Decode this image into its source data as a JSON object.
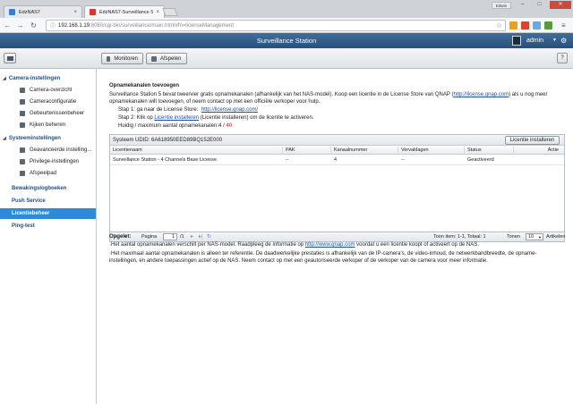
{
  "browser": {
    "tabs": [
      {
        "title": "EdzNAS7",
        "active": false
      },
      {
        "title": "EdzNAS7-Surveillance St",
        "active": true
      }
    ],
    "profile": "Edwin",
    "url_host": "192.168.1.19",
    "url_path": ":8080/cgi-bin/surveillance/main.html#fn=licenseManagement"
  },
  "app": {
    "title": "Surveillance Station",
    "user": "admin",
    "monitor_label": "Monitoren",
    "playback_label": "Afspelen",
    "help_label": "?"
  },
  "sidebar": {
    "groups": [
      {
        "label": "Camera-instellingen",
        "items": [
          "Camera-overzicht",
          "Cameraconfiguratie",
          "Gebeurtenissenbeheer",
          "Kijken beheren"
        ]
      },
      {
        "label": "Systeeminstellingen",
        "items": [
          "Geavanceerde instelling...",
          "Privilege-instellingen",
          "Afspeelpad"
        ]
      }
    ],
    "top_items": [
      "Bewakingslogboeken",
      "Push Service",
      "Licentiebeheer",
      "Ping-test"
    ],
    "active": "Licentiebeheer"
  },
  "main": {
    "heading": "Opnamekanalen toevoegen",
    "intro_1": "Surveillance Station 5 bevat twee/vier gratis opnamekanalen (afhankelijk van het NAS-model). Koop een licentie in de License Store van QNAP (",
    "intro_link": "http://license.qnap.com",
    "intro_2": ") als u nog meer",
    "intro_3": "opnamekanalen wilt toevoegen, of neem contact op met een officiële verkoper voor hulp.",
    "step1_text": "Stap 1: ga naar de License Store:",
    "step1_link": "http://license.qnap.com/",
    "step2_text": "Stap 2: Klik op",
    "step2_link": "Licentie installeren",
    "step2_rest": "(Licentie installeren) om de licentie te activeren.",
    "current_text": "Huidig / maximum aantal opnamekanalen:4 /",
    "current_max": "40"
  },
  "grid": {
    "udid_label": "Systeem UDID: 6A618950EED89BQ152E000",
    "install_button": "Licentie installeren",
    "columns": [
      "Licentienaam",
      "PAK",
      "Kanaalnummer",
      "Vervaldagen",
      "Status",
      "Actie"
    ],
    "rows": [
      {
        "name": "Surveillance Station - 4 Channels Base License",
        "pak": "--",
        "channels": "4",
        "expiry": "--",
        "status": "Geactiveerd",
        "action": ""
      }
    ]
  },
  "pager": {
    "page_label": "Pagina",
    "page_value": "1",
    "page_total": "/1",
    "summary": "Toon item: 1-1, Totaal: 1",
    "show_label": "Tonen",
    "per_page": "10",
    "items_label": "Artikelen"
  },
  "notes": {
    "title": "Opgelet:",
    "note1_a": "·Het aantal opnamekanalen verschilt per NAS-model. Raadpleeg de informatie op",
    "note1_link": "http://www.qnap.com",
    "note1_b": "voordat u een licentie koopt of activeert op de NAS.",
    "note2_line1": "·Het maximaal aantal opnamekanalen is alleen ter referentie. De daadwerkelijke prestaties is afhankelijk van de IP-camera's, de video-inhoud, de netwerkbandbreedte, de opname-",
    "note2_line2": "instellingen, en andere toepassingen actief op de NAS. Neem contact op met een geautoriseerde verkoper of de verkoper van de camera voor meer informatie."
  },
  "colors": {
    "header": "#2f5d8a",
    "active_nav": "#2c8ad9",
    "link": "#1a4fa3",
    "max_red": "#c02020"
  }
}
